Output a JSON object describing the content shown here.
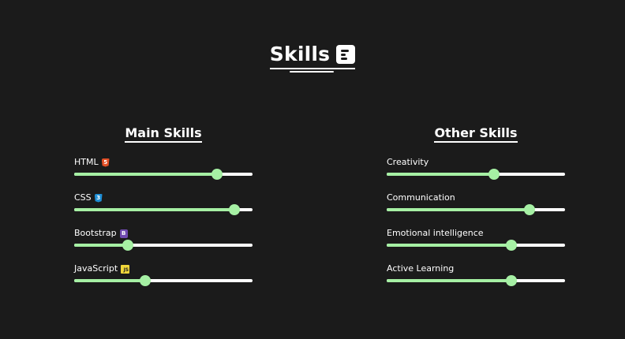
{
  "header": {
    "title": "Skills",
    "title_icon": "text-lines-icon"
  },
  "main_skills": {
    "heading": "Main Skills",
    "items": [
      {
        "label": "HTML",
        "icon": "html5-icon",
        "level": 0.8
      },
      {
        "label": "CSS",
        "icon": "css3-icon",
        "level": 0.9
      },
      {
        "label": "Bootstrap",
        "icon": "bootstrap-icon",
        "level": 0.3
      },
      {
        "label": "JavaScript",
        "icon": "javascript-icon",
        "level": 0.4
      }
    ]
  },
  "other_skills": {
    "heading": "Other Skills",
    "items": [
      {
        "label": "Creativity",
        "level": 0.6
      },
      {
        "label": "Communication",
        "level": 0.8
      },
      {
        "label": "Emotional intelligence",
        "level": 0.7
      },
      {
        "label": "Active Learning",
        "level": 0.7
      }
    ]
  },
  "colors": {
    "background": "#1b1b1b",
    "text": "#ffffff",
    "slider_fill": "#a6f0a4",
    "slider_track": "#ffffff",
    "html5": "#e34f26",
    "css3": "#1f8fd6",
    "bootstrap": "#6f4ab0",
    "javascript": "#f1d73a"
  }
}
